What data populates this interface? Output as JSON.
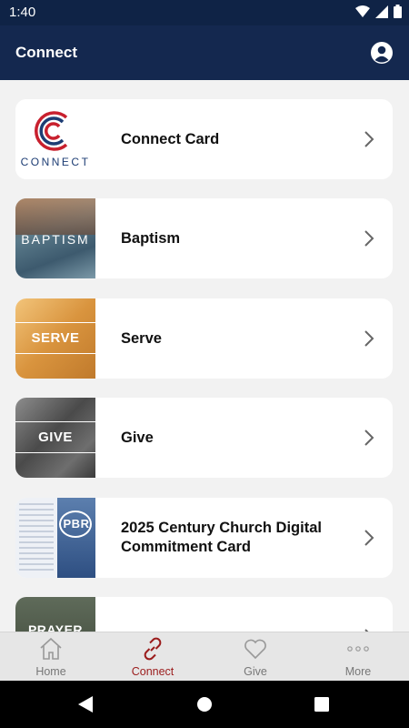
{
  "status": {
    "time": "1:40"
  },
  "app_bar": {
    "title": "Connect"
  },
  "cards": [
    {
      "label": "Connect Card",
      "thumb_text": "CONNECT"
    },
    {
      "label": "Baptism",
      "thumb_text": "BAPTISM"
    },
    {
      "label": "Serve",
      "thumb_text": "SERVE"
    },
    {
      "label": "Give",
      "thumb_text": "GIVE"
    },
    {
      "label": "2025 Century Church Digital Commitment Card",
      "thumb_text": "PBR"
    },
    {
      "label": "",
      "thumb_text": "PRAYER"
    }
  ],
  "bottom_nav": [
    {
      "label": "Home",
      "icon": "home-icon"
    },
    {
      "label": "Connect",
      "icon": "link-icon",
      "active": true
    },
    {
      "label": "Give",
      "icon": "heart-icon"
    },
    {
      "label": "More",
      "icon": "more-icon"
    }
  ],
  "colors": {
    "header": "#14284f",
    "active": "#9b1c1c",
    "logo_red": "#c8202e",
    "logo_blue": "#1d3d74"
  }
}
